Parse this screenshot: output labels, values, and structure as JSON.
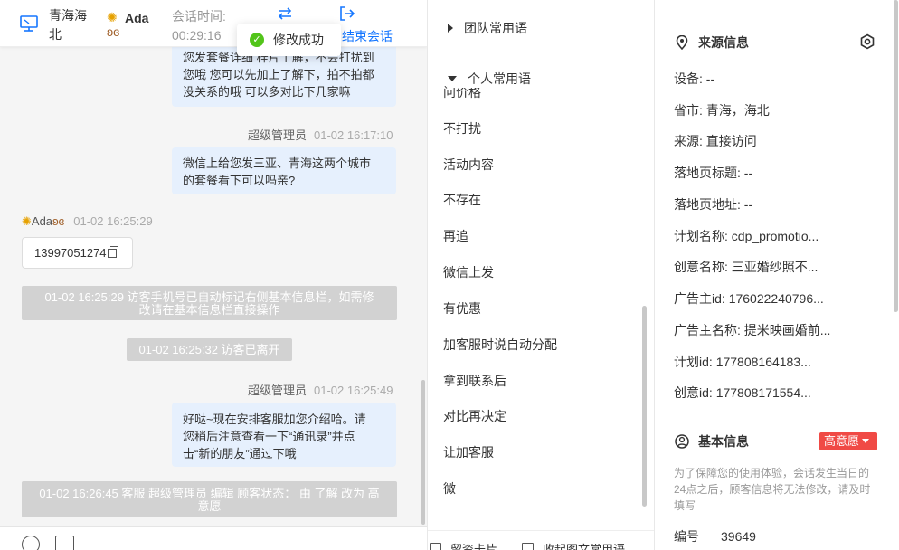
{
  "header": {
    "location": "青海海北",
    "user_name": "Ada",
    "session_label": "会话时间:",
    "session_time": "00:29:16",
    "end_label": "结束会话"
  },
  "toast": {
    "text": "修改成功"
  },
  "messages": {
    "m1_line0": "您发套餐详细 梓片了解，不会打扰到",
    "m1_line1": "您哦 您可以先加上了解下，拍不拍都",
    "m1_line2": "没关系的哦 可以多对比下几家嘛",
    "s2_name": "超级管理员",
    "s2_time": "01-02 16:17:10",
    "m2_line0": "微信上给您发三亚、青海这两个城市",
    "m2_line1": "的套餐看下可以吗亲?",
    "s3_name": "Ada",
    "s3_time": "01-02 16:25:29",
    "phone": "13997051274",
    "sys1_line0": "01-02 16:25:29 访客手机号已自动标记右侧基本信息栏，如需修",
    "sys1_line1": "改请在基本信息栏直接操作",
    "sys2": "01-02 16:25:32 访客已离开",
    "s4_name": "超级管理员",
    "s4_time": "01-02 16:25:49",
    "m4_line0": "好哒~现在安排客服加您介绍哈。请",
    "m4_line1": "您稍后注意查看一下“通讯录”并点",
    "m4_line2": "击“新的朋友”通过下哦",
    "sys3_line0": "01-02 16:26:45 客服 超级管理员 编辑 顾客状态： 由 了解 改为 高",
    "sys3_line1": "意愿"
  },
  "phrases": {
    "team_group": "团队常用语",
    "personal_group": "个人常用语",
    "partial_item": "问价格",
    "items": [
      "不打扰",
      "活动内容",
      "不存在",
      "再追",
      "微信上发",
      "有优惠",
      "加客服时说自动分配",
      "拿到联系后",
      "对比再决定",
      "让加客服",
      "微"
    ],
    "footer_card": "留资卡片",
    "footer_collapse": "收起图文常用语"
  },
  "source_info": {
    "title": "来源信息",
    "device_label": "设备:",
    "device_value": "--",
    "city_label": "省市:",
    "city_value": "青海，海北",
    "from_label": "来源:",
    "from_value": "直接访问",
    "landing_title_label": "落地页标题:",
    "landing_title_value": "--",
    "landing_url_label": "落地页地址:",
    "landing_url_value": "--",
    "plan_name_label": "计划名称:",
    "plan_name_value": "cdp_promotio...",
    "creative_name_label": "创意名称:",
    "creative_name_value": "三亚婚纱照不...",
    "advertiser_id_label": "广告主id:",
    "advertiser_id_value": "176022240796...",
    "advertiser_name_label": "广告主名称:",
    "advertiser_name_value": "提米映画婚前...",
    "plan_id_label": "计划id:",
    "plan_id_value": "177808164183...",
    "creative_id_label": "创意id:",
    "creative_id_value": "177808171554..."
  },
  "basic_info": {
    "title": "基本信息",
    "intent": "高意愿",
    "note": "为了保障您的使用体验，会话发生当日的24点之后，顾客信息将无法修改，请及时填写",
    "number_label": "编号",
    "number_value": "39649"
  }
}
